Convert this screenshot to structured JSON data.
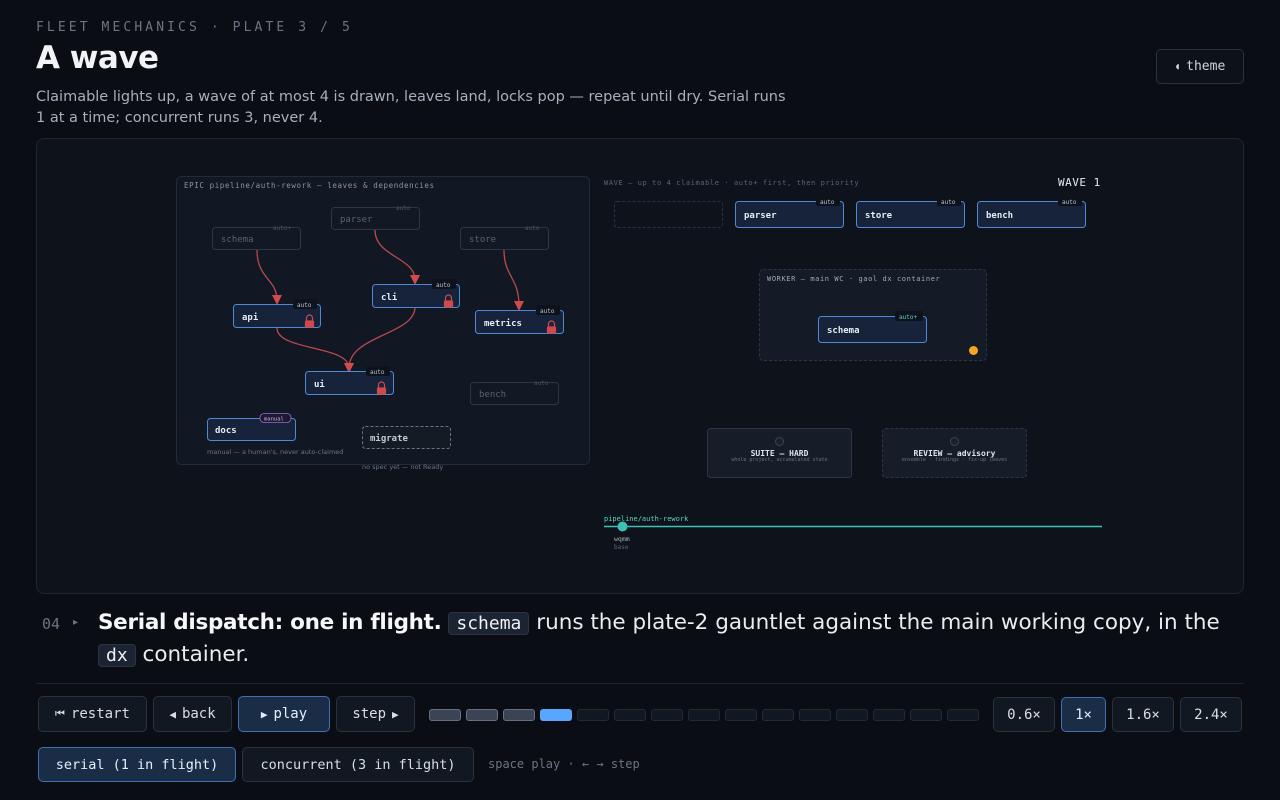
{
  "header": {
    "eyebrow": "FLEET MECHANICS · PLATE 3 / 5",
    "title": "A wave",
    "subtitle": "Claimable lights up, a wave of at most 4 is drawn, leaves land, locks pop — repeat until dry. Serial runs 1 at a time; concurrent runs 3, never 4.",
    "theme_icon": "half-moon-icon",
    "theme_label": "theme"
  },
  "diagram": {
    "epic_label": "EPIC pipeline/auth-rework — leaves & dependencies",
    "wave_caption": "WAVE — up to 4 claimable · auto+ first, then priority",
    "wave_title": "WAVE 1",
    "worker_label": "WORKER — main WC · gaol dx container",
    "suite": {
      "title": "SUITE — HARD",
      "sub": "whole project, accumulated state"
    },
    "review": {
      "title": "REVIEW — advisory",
      "sub": "ensemble · findings · fix-up leaves"
    },
    "branch_label": "pipeline/auth-rework",
    "commit_label": "wqmm",
    "commit_sub": "base",
    "docs_note": "manual — a human's, never auto-claimed",
    "migrate_note": "no spec yet — not Ready",
    "nodes": [
      {
        "id": "schema",
        "tag": "auto+",
        "state": "dim"
      },
      {
        "id": "parser",
        "tag": "auto",
        "state": "dim"
      },
      {
        "id": "store",
        "tag": "auto",
        "state": "dim"
      },
      {
        "id": "api",
        "tag": "auto",
        "state": "locked"
      },
      {
        "id": "cli",
        "tag": "auto",
        "state": "locked"
      },
      {
        "id": "metrics",
        "tag": "auto",
        "state": "locked"
      },
      {
        "id": "ui",
        "tag": "auto",
        "state": "locked"
      },
      {
        "id": "bench",
        "tag": "auto",
        "state": "dim"
      },
      {
        "id": "docs",
        "tag": "manual",
        "state": "manual"
      },
      {
        "id": "migrate",
        "tag": "",
        "state": "draft"
      }
    ],
    "wave_slots": [
      {
        "id": "",
        "tag": ""
      },
      {
        "id": "parser",
        "tag": "auto"
      },
      {
        "id": "store",
        "tag": "auto"
      },
      {
        "id": "bench",
        "tag": "auto"
      }
    ],
    "worker_node": {
      "id": "schema",
      "tag": "auto+"
    }
  },
  "step": {
    "number": "04",
    "lead": "Serial dispatch: one in flight.",
    "code1": "schema",
    "mid": " runs the plate-2 gauntlet against the main working copy, in the ",
    "code2": "dx",
    "tail": "container."
  },
  "controls": {
    "restart": "restart",
    "restart_icon": "skip-back-icon",
    "back": "back",
    "back_icon": "triangle-left-icon",
    "play": "play",
    "play_icon": "triangle-right-icon",
    "step": "step",
    "step_icon": "triangle-right-icon",
    "progress": {
      "total": 15,
      "done": 3,
      "current": 4
    },
    "speeds": [
      "0.6×",
      "1×",
      "1.6×",
      "2.4×"
    ],
    "speed_selected": "1×",
    "modes": [
      "serial (1 in flight)",
      "concurrent (3 in flight)"
    ],
    "mode_selected": "serial (1 in flight)",
    "hint": "space play · ← → step"
  },
  "colors": {
    "accent": "#58a6ff",
    "lock": "#d0494d",
    "edge": "#c44c4f",
    "teal": "#3fbfb5",
    "worker_dot": "#f5a623"
  }
}
